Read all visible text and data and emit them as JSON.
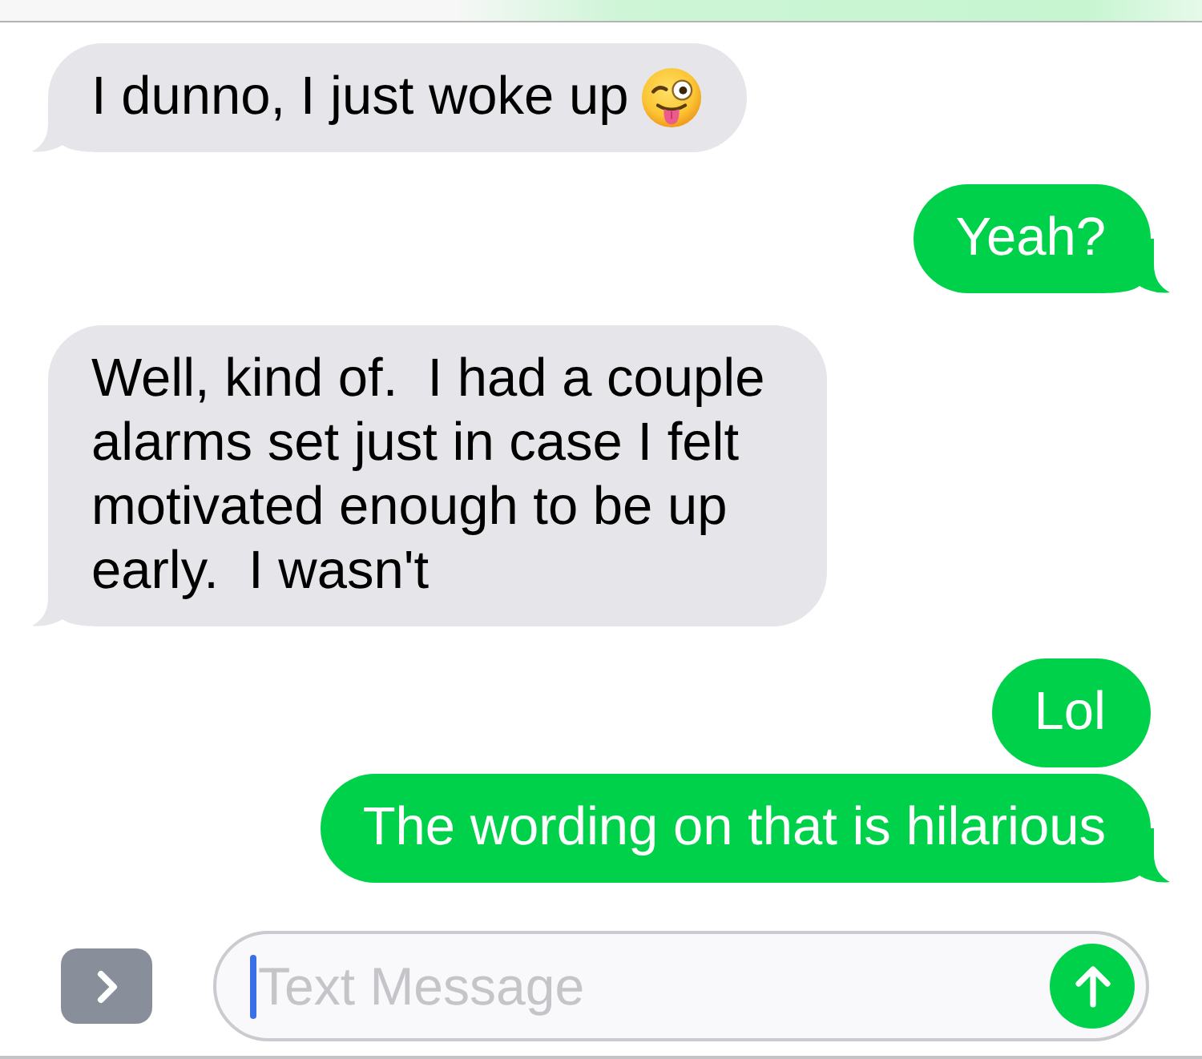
{
  "messages": [
    {
      "kind": "received",
      "text": "I dunno, I just woke up",
      "emoji": true,
      "tail": true
    },
    {
      "kind": "sent",
      "text": "Yeah?",
      "emoji": false,
      "tail": true
    },
    {
      "kind": "received",
      "text": "Well, kind of.  I had a couple alarms set just in case I felt motivated enough to be up early.  I wasn't",
      "emoji": false,
      "tail": true
    },
    {
      "kind": "sent",
      "text": "Lol",
      "emoji": false,
      "tail": false
    },
    {
      "kind": "sent",
      "text": "The wording on that is hilarious",
      "emoji": false,
      "tail": true
    }
  ],
  "composer": {
    "placeholder": "Text Message",
    "focused": true
  }
}
